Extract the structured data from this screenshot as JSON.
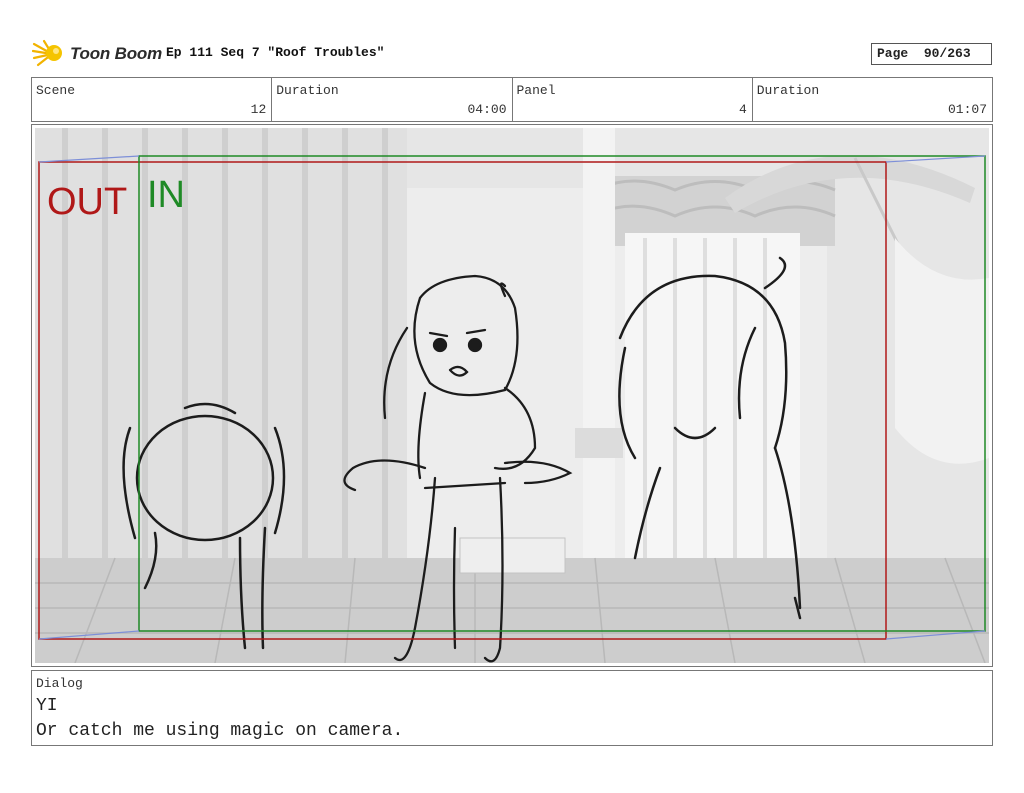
{
  "header": {
    "logo_text": "Toon Boom",
    "title": "Ep 111 Seq 7 \"Roof Troubles\"",
    "page_label": "Page",
    "page_value": "90/263"
  },
  "info": {
    "scene_label": "Scene",
    "scene_value": "12",
    "scene_duration_label": "Duration",
    "scene_duration_value": "04:00",
    "panel_label": "Panel",
    "panel_value": "4",
    "panel_duration_label": "Duration",
    "panel_duration_value": "01:07"
  },
  "panel": {
    "out_label": "OUT",
    "in_label": "IN",
    "out_color": "#b01818",
    "in_color": "#1f8a26",
    "background_color": "#e4e4e4"
  },
  "dialog": {
    "label": "Dialog",
    "speaker": "YI",
    "line": "Or catch me using magic on camera."
  }
}
